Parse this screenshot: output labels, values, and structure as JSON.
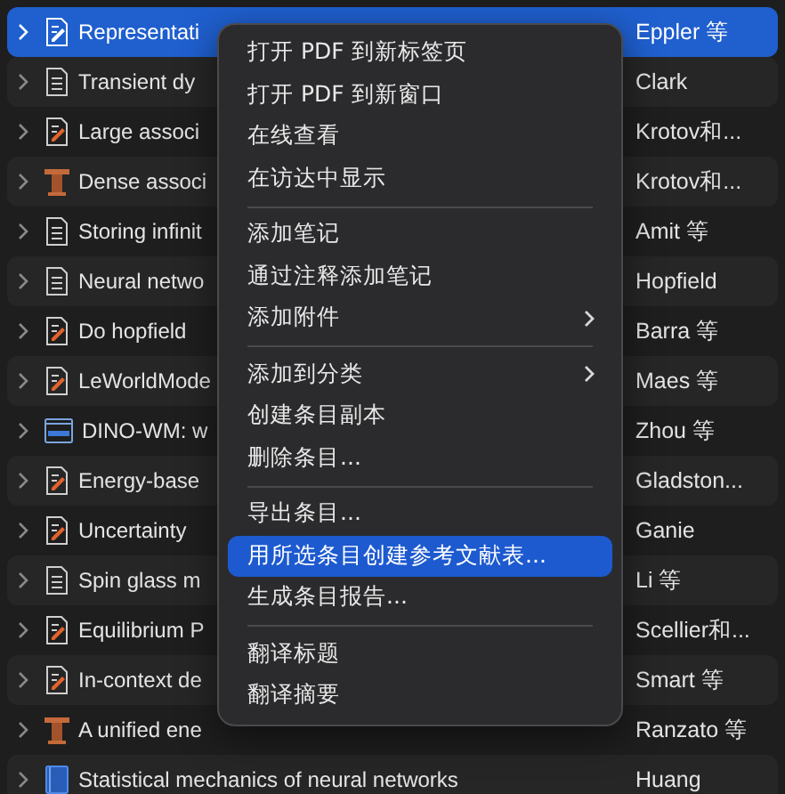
{
  "rows": [
    {
      "title": "Representati",
      "creator": "Eppler 等",
      "kind": "preprint",
      "selected": true
    },
    {
      "title": "Transient dy",
      "creator": "Clark",
      "kind": "document",
      "selected": false
    },
    {
      "title": "Large associ",
      "creator": "Krotov和...",
      "kind": "preprint",
      "selected": false
    },
    {
      "title": "Dense associ",
      "creator": "Krotov和...",
      "kind": "lecture",
      "selected": false
    },
    {
      "title": "Storing infinit",
      "creator": "Amit 等",
      "kind": "document",
      "selected": false
    },
    {
      "title": "Neural netwo",
      "creator": "Hopfield",
      "kind": "document",
      "selected": false
    },
    {
      "title": "Do hopfield",
      "creator": "Barra 等",
      "kind": "preprint",
      "selected": false
    },
    {
      "title": "LeWorldMode",
      "creator": "Maes 等",
      "kind": "preprint",
      "selected": false
    },
    {
      "title": "DINO-WM: w",
      "creator": "Zhou 等",
      "kind": "webpage",
      "selected": false
    },
    {
      "title": "Energy-base",
      "creator": "Gladston...",
      "kind": "preprint",
      "selected": false
    },
    {
      "title": "Uncertainty",
      "creator": "Ganie",
      "kind": "preprint",
      "selected": false
    },
    {
      "title": "Spin glass m",
      "creator": "Li 等",
      "kind": "document",
      "selected": false
    },
    {
      "title": "Equilibrium P",
      "creator": "Scellier和...",
      "kind": "preprint",
      "selected": false
    },
    {
      "title": "In-context de",
      "creator": "Smart 等",
      "kind": "preprint",
      "selected": false
    },
    {
      "title": "A unified ene",
      "creator": "Ranzato 等",
      "kind": "lecture",
      "selected": false
    },
    {
      "title": "Statistical mechanics of neural networks",
      "creator": "Huang",
      "kind": "book",
      "selected": false
    }
  ],
  "context_menu": {
    "groups": [
      [
        {
          "label": "打开 PDF 到新标签页",
          "submenu": false,
          "selected": false
        },
        {
          "label": "打开 PDF 到新窗口",
          "submenu": false,
          "selected": false
        },
        {
          "label": "在线查看",
          "submenu": false,
          "selected": false
        },
        {
          "label": "在访达中显示",
          "submenu": false,
          "selected": false
        }
      ],
      [
        {
          "label": "添加笔记",
          "submenu": false,
          "selected": false
        },
        {
          "label": "通过注释添加笔记",
          "submenu": false,
          "selected": false
        },
        {
          "label": "添加附件",
          "submenu": true,
          "selected": false
        }
      ],
      [
        {
          "label": "添加到分类",
          "submenu": true,
          "selected": false
        },
        {
          "label": "创建条目副本",
          "submenu": false,
          "selected": false
        },
        {
          "label": "删除条目...",
          "submenu": false,
          "selected": false
        }
      ],
      [
        {
          "label": "导出条目...",
          "submenu": false,
          "selected": false
        },
        {
          "label": "用所选条目创建参考文献表...",
          "submenu": false,
          "selected": true
        },
        {
          "label": "生成条目报告...",
          "submenu": false,
          "selected": false
        }
      ],
      [
        {
          "label": "翻译标题",
          "submenu": false,
          "selected": false
        },
        {
          "label": "翻译摘要",
          "submenu": false,
          "selected": false
        }
      ]
    ]
  }
}
